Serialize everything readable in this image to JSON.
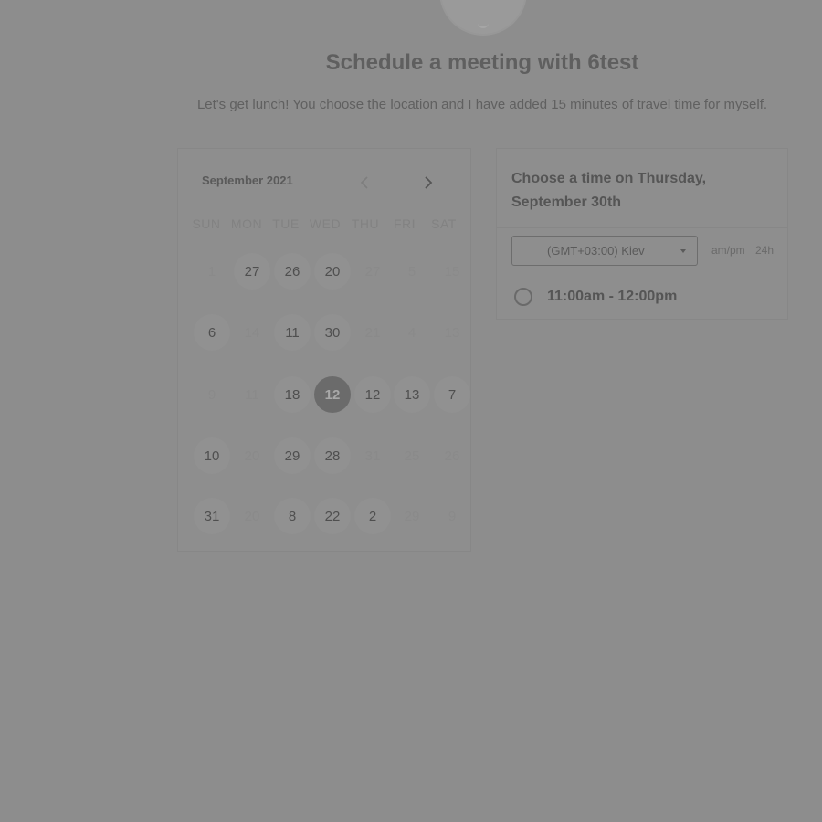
{
  "header": {
    "title": "Schedule a meeting with 6test",
    "description": "Let's get lunch! You choose the location and I have added 15 minutes of travel time for myself."
  },
  "calendar": {
    "month_label": "September 2021",
    "weekdays": [
      "SUN",
      "MON",
      "TUE",
      "WED",
      "THU",
      "FRI",
      "SAT"
    ],
    "weeks": [
      [
        {
          "label": "1",
          "available": false
        },
        {
          "label": "27",
          "available": true
        },
        {
          "label": "26",
          "available": true
        },
        {
          "label": "20",
          "available": true
        },
        {
          "label": "27",
          "available": false
        },
        {
          "label": "5",
          "available": false
        },
        {
          "label": "15",
          "available": false
        }
      ],
      [
        {
          "label": "6",
          "available": true
        },
        {
          "label": "14",
          "available": false
        },
        {
          "label": "11",
          "available": true
        },
        {
          "label": "30",
          "available": true
        },
        {
          "label": "21",
          "available": false
        },
        {
          "label": "4",
          "available": false
        },
        {
          "label": "13",
          "available": false
        }
      ],
      [
        {
          "label": "9",
          "available": false
        },
        {
          "label": "11",
          "available": false
        },
        {
          "label": "18",
          "available": true
        },
        {
          "label": "12",
          "available": true,
          "selected": true
        },
        {
          "label": "12",
          "available": true
        },
        {
          "label": "13",
          "available": true
        },
        {
          "label": "7",
          "available": true
        }
      ],
      [
        {
          "label": "10",
          "available": true
        },
        {
          "label": "20",
          "available": false
        },
        {
          "label": "29",
          "available": true
        },
        {
          "label": "28",
          "available": true
        },
        {
          "label": "31",
          "available": false
        },
        {
          "label": "25",
          "available": false
        },
        {
          "label": "26",
          "available": false
        }
      ],
      [
        {
          "label": "31",
          "available": true
        },
        {
          "label": "20",
          "available": false
        },
        {
          "label": "8",
          "available": true
        },
        {
          "label": "22",
          "available": true
        },
        {
          "label": "2",
          "available": true
        },
        {
          "label": "29",
          "available": false
        },
        {
          "label": "9",
          "available": false
        }
      ]
    ]
  },
  "time_picker": {
    "heading": "Choose a time on Thursday, September 30th",
    "timezone": "(GMT+03:00) Kiev",
    "format_ampm": "am/pm",
    "format_24h": "24h",
    "slots": [
      "11:00am - 12:00pm"
    ]
  },
  "colors": {
    "overlay": "#8d8d8d",
    "selected_day": "#6b6b6b"
  }
}
